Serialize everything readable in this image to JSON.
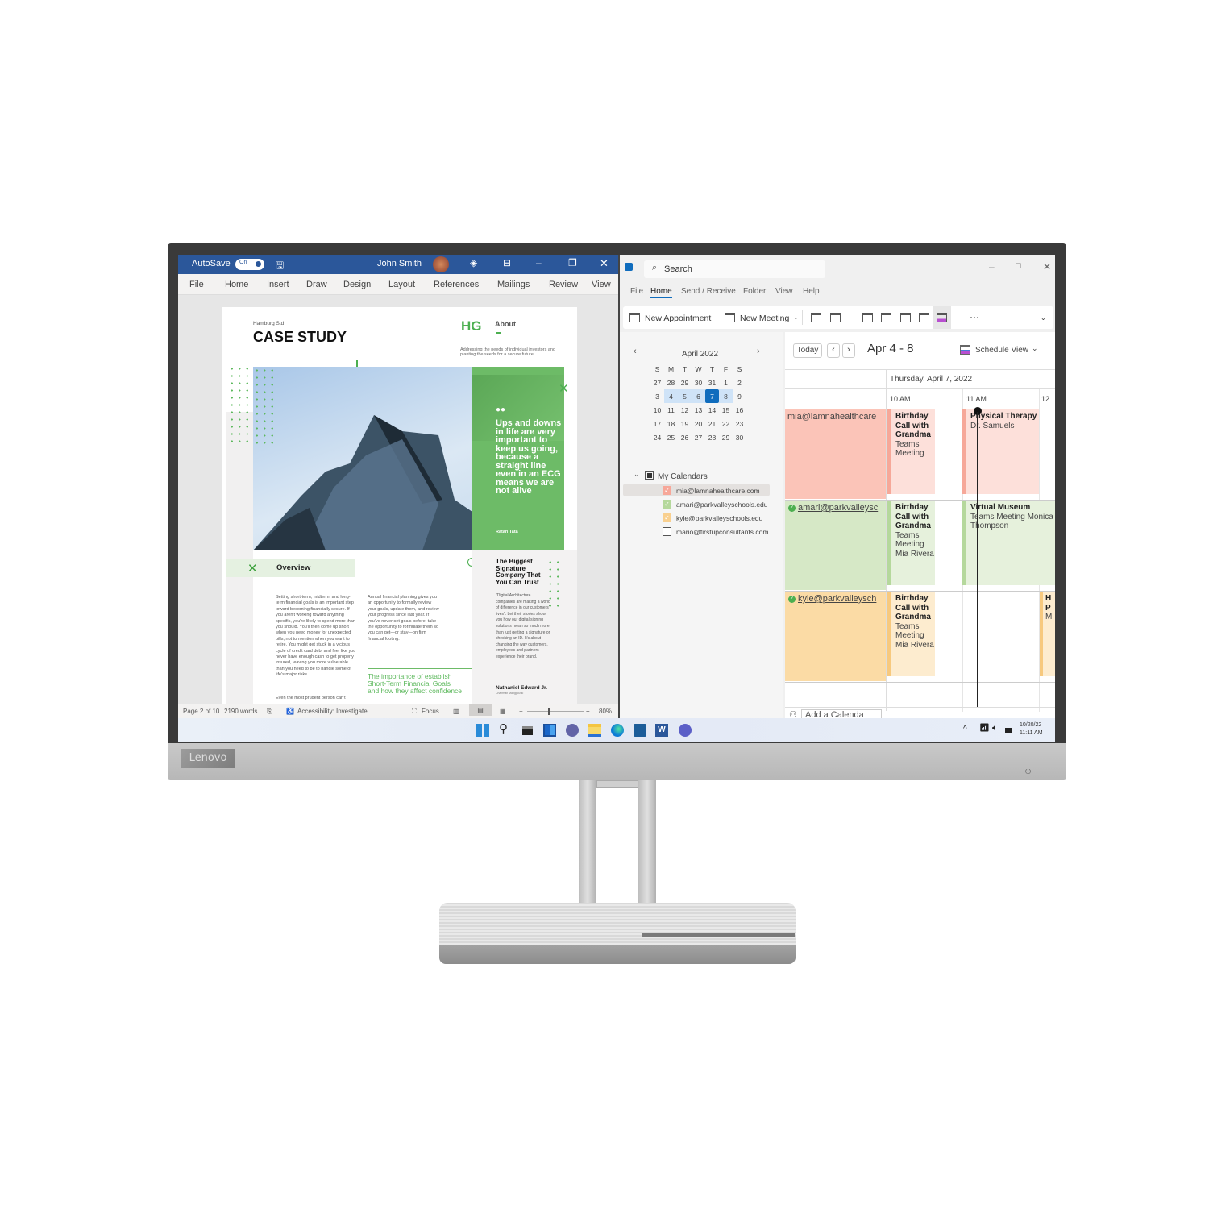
{
  "brand": "Lenovo",
  "word": {
    "autosave_label": "AutoSave",
    "autosave_state": "On",
    "user_name": "John Smith",
    "menu": [
      "File",
      "Home",
      "Insert",
      "Draw",
      "Design",
      "Layout",
      "References",
      "Mailings",
      "Review",
      "View"
    ],
    "doc": {
      "kicker": "Hamburg Std",
      "title": "CASE STUDY",
      "logo": "HG",
      "about_heading": "About",
      "about_text": "Addressing the needs of individual investors and planting the seeds for a secure future.",
      "quote": "Ups and downs in life are very important to keep us going, because a straight line even in an ECG means we are not alive",
      "quote_author": "Ratan Tata",
      "overview_heading": "Overview",
      "overview_p1": "Setting short-term, midterm, and long-term financial goals is an important step toward becoming financially secure. If you aren't working toward anything specific, you're likely to spend more than you should. You'll then come up short when you need money for unexpected bills, not to mention when you want to retire. You might get stuck in a vicious cycle of credit card debt and feel like you never have enough cash to get properly insured, leaving you more vulnerable than you need to be to handle some of life's major risks.",
      "overview_p2": "Even the most prudent person can't",
      "col2_text": "Annual financial planning gives you an opportunity to formally review your goals, update them, and review your progress since last year. If you've never set goals before, take the opportunity to formulate them so you can get—or stay—on firm financial footing.",
      "col2_highlight": "The importance of establish Short-Term Financial Goals and how they affect confidence",
      "side_heading": "The Biggest Signature Company That You Can Trust",
      "side_text": "\"Digital Architecture companies are making a world of difference in our customers' lives\". Let their stories show you how our digital signing solutions mean so much more than just getting a signature or checking an ID. It's about changing the way customers, employees and partners experience their brand.",
      "side_author": "Nathaniel Edward Jr.",
      "side_author_title": "Chairman Manggo0tic"
    },
    "status": {
      "page": "Page 2 of 10",
      "words": "2190 words",
      "accessibility": "Accessibility: Investigate",
      "focus": "Focus",
      "zoom": "80%",
      "zoom_level": 0.8
    }
  },
  "outlook": {
    "search_placeholder": "Search",
    "menu": [
      "File",
      "Home",
      "Send / Receive",
      "Folder",
      "View",
      "Help"
    ],
    "active_menu": "Home",
    "ribbon": {
      "new_appointment": "New Appointment",
      "new_meeting": "New Meeting",
      "more": "···"
    },
    "mini_cal": {
      "month": "April 2022",
      "weekdays": [
        "S",
        "M",
        "T",
        "W",
        "T",
        "F",
        "S"
      ],
      "weeks": [
        [
          "27",
          "28",
          "29",
          "30",
          "31",
          "1",
          "2"
        ],
        [
          "3",
          "4",
          "5",
          "6",
          "7",
          "8",
          "9"
        ],
        [
          "10",
          "11",
          "12",
          "13",
          "14",
          "15",
          "16"
        ],
        [
          "17",
          "18",
          "19",
          "20",
          "21",
          "22",
          "23"
        ],
        [
          "24",
          "25",
          "26",
          "27",
          "28",
          "29",
          "30"
        ]
      ],
      "selected": "7",
      "range": [
        "4",
        "5",
        "6",
        "7",
        "8"
      ]
    },
    "calendars_group": "My Calendars",
    "calendars": [
      {
        "name": "mia@lamnahealthcare.com",
        "color": "#f7a799",
        "checked": true
      },
      {
        "name": "amari@parkvalleyschools.edu",
        "color": "#b5d89c",
        "checked": true
      },
      {
        "name": "kyle@parkvalleyschools.edu",
        "color": "#f9d08f",
        "checked": true
      },
      {
        "name": "mario@firstupconsultants.com",
        "color": "#ffffff",
        "checked": false
      }
    ],
    "today_button": "Today",
    "date_range": "Apr 4 - 8",
    "view_label": "Schedule View",
    "day_header": "Thursday, April 7, 2022",
    "hours": [
      "10 AM",
      "11 AM",
      "12"
    ],
    "rows": [
      {
        "calendar": "mia@lamnahealthcare",
        "events": [
          {
            "title": "Birthday Call with Grandma",
            "detail": "Teams Meeting"
          },
          {
            "title": "Physical Therapy",
            "detail": "Dr. Samuels"
          }
        ]
      },
      {
        "calendar": "amari@parkvalleysc",
        "events": [
          {
            "title": "Birthday Call with Grandma",
            "detail": "Teams Meeting Mia Rivera"
          },
          {
            "title": "Virtual Museum",
            "detail": "Teams Meeting Monica Thompson"
          }
        ]
      },
      {
        "calendar": "kyle@parkvalleysch",
        "events": [
          {
            "title": "Birthday Call with Grandma",
            "detail": "Teams Meeting Mia Rivera"
          },
          {
            "title": "H P",
            "detail": "M"
          }
        ]
      }
    ],
    "add_calendar": "Add a Calenda"
  },
  "taskbar": {
    "date": "10/20/22",
    "time": "11:11 AM",
    "icons": [
      "start",
      "search",
      "task-view",
      "widgets",
      "chat",
      "file-explorer",
      "edge",
      "store",
      "word",
      "teams"
    ]
  }
}
